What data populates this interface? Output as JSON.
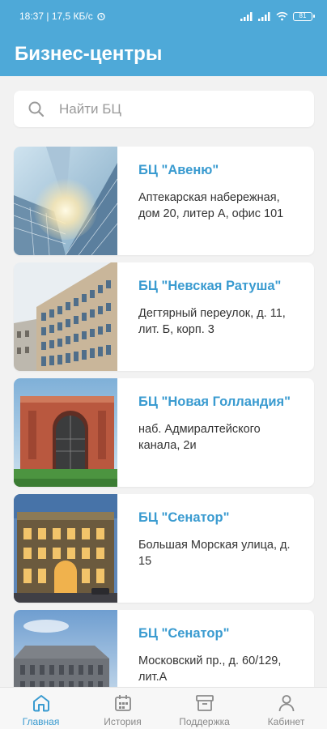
{
  "status_bar": {
    "time_info": "18:37 | 17,5 КБ/с",
    "battery": "81"
  },
  "app_bar": {
    "title": "Бизнес-центры"
  },
  "search": {
    "placeholder": "Найти БЦ"
  },
  "business_centers": [
    {
      "name": "БЦ \"Авеню\"",
      "address": "Аптекарская набережная, дом 20, литер А, офис 101"
    },
    {
      "name": "БЦ \"Невская Ратуша\"",
      "address": "Дегтярный переулок, д. 11, лит. Б, корп. 3"
    },
    {
      "name": "БЦ \"Новая Голландия\"",
      "address": "наб. Адмиралтейского канала, 2и"
    },
    {
      "name": "БЦ \"Сенатор\"",
      "address": "Большая Морская улица, д. 15"
    },
    {
      "name": "БЦ \"Сенатор\"",
      "address": "Московский пр., д. 60/129, лит.А"
    }
  ],
  "bottom_nav": [
    {
      "label": "Главная",
      "icon": "home-icon",
      "active": true
    },
    {
      "label": "История",
      "icon": "calendar-icon",
      "active": false
    },
    {
      "label": "Поддержка",
      "icon": "archive-box-icon",
      "active": false
    },
    {
      "label": "Кабинет",
      "icon": "person-icon",
      "active": false
    }
  ],
  "colors": {
    "accent": "#4ea9d8",
    "title_blue": "#3a9bd0",
    "background": "#f2f2f2"
  }
}
